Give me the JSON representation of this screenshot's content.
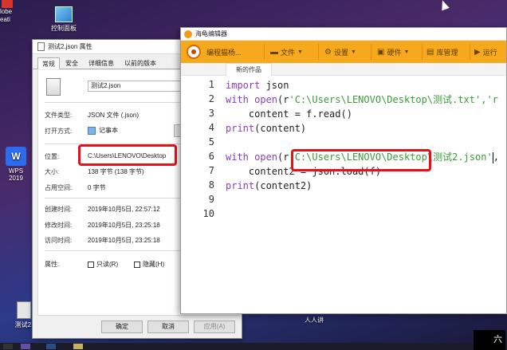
{
  "desktop": {
    "top_left_line1": "lobe",
    "top_left_line2": "eati",
    "control_panel_label": "控制面板",
    "wps_label": "WPS 2019",
    "wps_glyph": "W",
    "test2_label": "测试2.",
    "renren_label": "人人讲"
  },
  "taskbar": {
    "tray_text": "六"
  },
  "properties": {
    "title": "测试2.json 属性",
    "tabs": [
      "常规",
      "安全",
      "详细信息",
      "以前的版本"
    ],
    "filename": "测试2.json",
    "rows": {
      "type_label": "文件类型:",
      "type_value": "JSON 文件 (.json)",
      "open_label": "打开方式:",
      "open_value": "记事本",
      "location_label": "位置:",
      "location_value": "C:\\Users\\LENOVO\\Desktop",
      "size_label": "大小:",
      "size_value": "138 字节 (138 字节)",
      "disk_label": "占用空间:",
      "disk_value": "0 字节",
      "created_label": "创建时间:",
      "created_value": "2019年10月5日, 22:57:12",
      "modified_label": "修改时间:",
      "modified_value": "2019年10月5日, 23:25:18",
      "accessed_label": "访问时间:",
      "accessed_value": "2019年10月5日, 23:25:18",
      "attr_label": "属性:",
      "readonly_label": "只读(R)",
      "hidden_label": "隐藏(H)"
    },
    "buttons": {
      "ok": "确定",
      "cancel": "取消",
      "apply": "应用(A)"
    }
  },
  "editor": {
    "title": "海龟编辑器",
    "toolbar": {
      "brand": "编程猫杨...",
      "file": "文件",
      "settings": "设置",
      "hardware": "硬件",
      "library": "库管理",
      "run": "运行"
    },
    "tab": "新的作品",
    "line_numbers": [
      "1",
      "2",
      "3",
      "4",
      "5",
      "6",
      "7",
      "8",
      "9",
      "10"
    ],
    "code": {
      "l1_kw": "import",
      "l1_rest": " json",
      "l2_kw": "with",
      "l2_fn": " open",
      "l2_a": "(r",
      "l2_str": "'C:\\Users\\LENOVO\\Desktop\\测试.txt'",
      "l2_b": ",'r",
      "l3": "    content = f.read()",
      "l4_fn": "print",
      "l4_rest": "(content)",
      "l6_kw": "with",
      "l6_fn": " open",
      "l6_a": "(r",
      "l6_str": "'C:\\Users\\LENOVO\\Desktop\\测试2.json'",
      "l6_b": ",",
      "l7": "    content2 = json.load(f)",
      "l8_fn": "print",
      "l8_rest": "(content2)"
    }
  },
  "colors": {
    "highlight": "#e8101a",
    "toolbar": "#f6a91c",
    "keyword": "#8a3fb8",
    "string": "#3a9a3a"
  }
}
